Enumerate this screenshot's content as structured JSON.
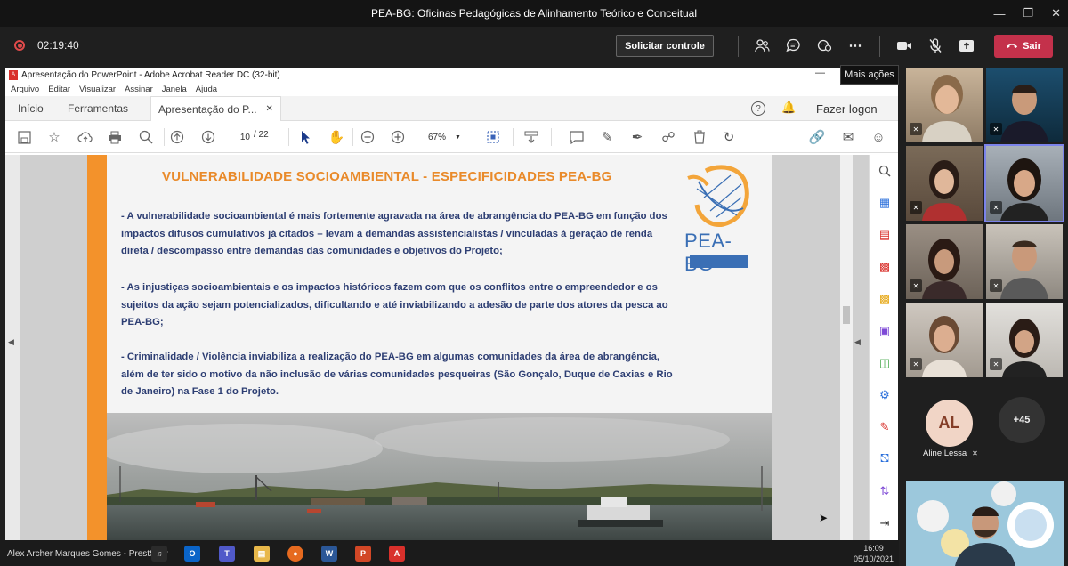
{
  "window": {
    "title": "PEA-BG: Oficinas Pedagógicas de Alinhamento Teórico e Conceitual"
  },
  "meeting": {
    "timer": "02:19:40",
    "request_control": "Solicitar controle",
    "leave": "Sair",
    "tooltip": "Mais ações"
  },
  "acrobat": {
    "title": "Apresentação do PowerPoint - Adobe Acrobat Reader DC (32-bit)",
    "menu": [
      "Arquivo",
      "Editar",
      "Visualizar",
      "Assinar",
      "Janela",
      "Ajuda"
    ],
    "tabs": {
      "home": "Início",
      "tools": "Ferramentas",
      "doc": "Apresentação do P..."
    },
    "login": "Fazer logon",
    "page_current": "10",
    "page_total": "/ 22",
    "zoom": "67%"
  },
  "slide": {
    "title": "VULNERABILIDADE SOCIOAMBIENTAL  -  ESPECIFICIDADES PEA-BG",
    "paragraphs": [
      "- A vulnerabilidade socioambiental é mais fortemente agravada na área de abrangência do PEA-BG em função dos impactos difusos cumulativos já citados – levam a demandas assistencialistas / vinculadas à geração de renda direta / descompasso entre demandas das comunidades e objetivos do Projeto;",
      " - As injustiças socioambientais e os impactos históricos fazem com que os conflitos entre o empreendedor e os sujeitos da ação sejam potencializados, dificultando e até inviabilizando a adesão de parte dos atores da pesca ao PEA-BG;",
      "- Criminalidade / Violência inviabiliza a realização do PEA-BG em algumas comunidades da área de abrangência, além de ter sido o motivo da não inclusão de várias comunidades pesqueiras (São Gonçalo, Duque de Caxias e Rio de Janeiro) na Fase 1 do Projeto."
    ],
    "logo_text": "PEA-BG"
  },
  "taskbar": {
    "speaker": "Alex Archer Marques Gomes - PrestServ",
    "time": "16:09",
    "date": "05/10/2021"
  },
  "participants": {
    "avatar_initials": "AL",
    "avatar_name": "Aline Lessa",
    "overflow": "+45"
  }
}
